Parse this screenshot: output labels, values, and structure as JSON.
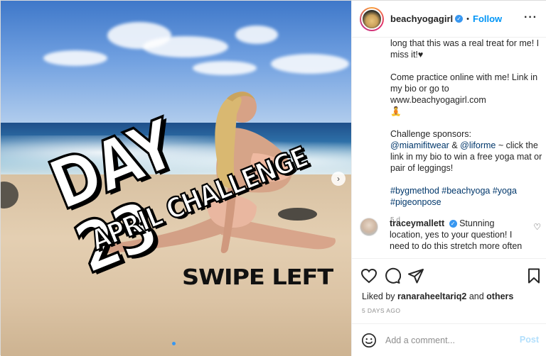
{
  "post": {
    "overlay": {
      "day": "DAY 23",
      "challenge": "APRIL CHALLENGE",
      "swipe": "SWIPE LEFT"
    }
  },
  "header": {
    "username": "beachyogagirl",
    "separator": "•",
    "follow_label": "Follow",
    "more_icon": "more-horizontal-icon"
  },
  "caption": {
    "p1": "long that this was a real treat for me! I miss it!♥",
    "p2_text": "Come practice online with me! Link in my bio or go to www.beachyogagirl.com",
    "p2_emoji": "🧘",
    "p3_intro": "Challenge sponsors:",
    "p3_mention1": "@miamifitwear",
    "p3_amp": "&",
    "p3_mention2": "@liforme",
    "p3_rest": "~ click the link in my bio to win a free yoga mat or pair of leggings!",
    "hashtags": "#bygmethod #beachyoga #yoga #pigeonpose",
    "time": "5 d"
  },
  "comment": {
    "username": "traceymallett",
    "text": "Stunning location, yes to your question! I need to do this stretch more often"
  },
  "likes": {
    "prefix": "Liked by",
    "user": "ranaraheeltariq2",
    "and": "and",
    "others": "others"
  },
  "posted": "5 DAYS AGO",
  "add_comment": {
    "placeholder": "Add a comment...",
    "post_label": "Post"
  },
  "colors": {
    "accent": "#0095f6",
    "verified": "#3897f0",
    "post_disabled": "#b2dffc"
  }
}
